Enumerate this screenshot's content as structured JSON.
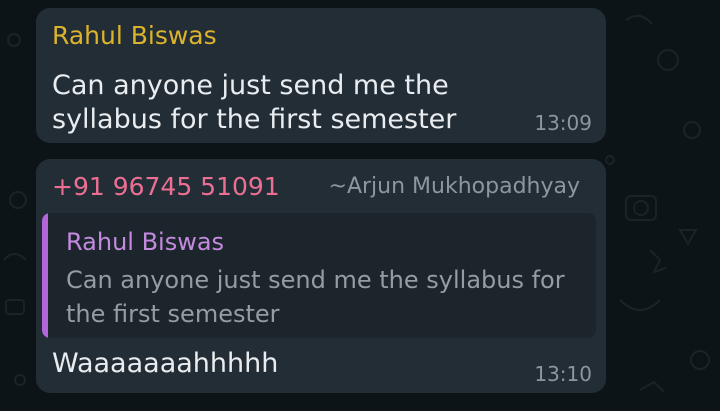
{
  "messages": [
    {
      "sender": "Rahul Biswas",
      "text": "Can anyone just send me the syllabus for the first semester",
      "time": "13:09"
    },
    {
      "sender": "+91 96745 51091",
      "push_name": "~Arjun Mukhopadhyay",
      "quoted": {
        "sender": "Rahul Biswas",
        "text": "Can anyone just send me the syllabus for the first semester"
      },
      "text": "Waaaaaaahhhhh",
      "time": "13:10"
    }
  ],
  "colors": {
    "background": "#0d1418",
    "bubble": "#232d36",
    "sender_1": "#dcb42c",
    "sender_2": "#ec6f93",
    "quote_accent": "#b366d9"
  }
}
